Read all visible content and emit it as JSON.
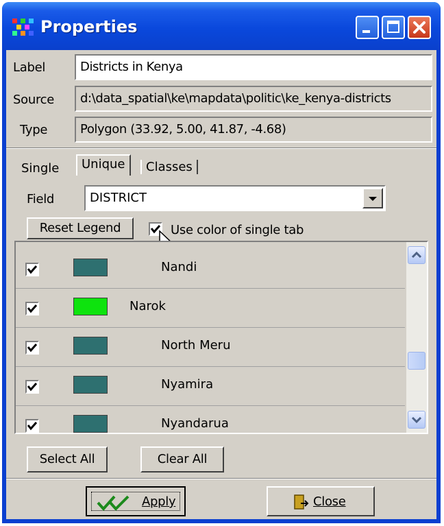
{
  "window": {
    "title": "Properties",
    "icon": "app-grid-icon",
    "controls": [
      "minimize-icon",
      "maximize-icon",
      "close-icon"
    ]
  },
  "layer": {
    "label_caption": "Label",
    "label_value": "Districts in Kenya",
    "source_caption": "Source",
    "source_value": "d:\\data_spatial\\ke\\mapdata\\politic\\ke_kenya-districts",
    "type_caption": "Type",
    "type_value": "Polygon   (33.92, 5.00, 41.87, -4.68)"
  },
  "tabs": [
    {
      "label": "Single",
      "active": false
    },
    {
      "label": "Unique",
      "active": true
    },
    {
      "label": "Classes",
      "active": false
    }
  ],
  "unique": {
    "field_caption": "Field",
    "field_value": "DISTRICT",
    "reset_legend_label": "Reset Legend",
    "use_color_label": "Use color of single tab",
    "use_color_checked": true,
    "items": [
      {
        "name": "Nandi",
        "checked": true,
        "color": "#2e7070"
      },
      {
        "name": "Narok",
        "checked": true,
        "color": "#0ee30e"
      },
      {
        "name": "North Meru",
        "checked": true,
        "color": "#2e7070"
      },
      {
        "name": "Nyamira",
        "checked": true,
        "color": "#2e7070"
      },
      {
        "name": "Nyandarua",
        "checked": true,
        "color": "#2e7070"
      }
    ],
    "select_all_label": "Select All",
    "clear_all_label": "Clear All"
  },
  "footer": {
    "apply_label": "Apply",
    "close_label": "Close",
    "apply_icon": "double-check-icon",
    "close_icon": "door-exit-icon"
  },
  "colors": {
    "titlebar": "#0a48dc",
    "dialog_face": "#d4d0c8",
    "close_button": "#c7371a"
  }
}
